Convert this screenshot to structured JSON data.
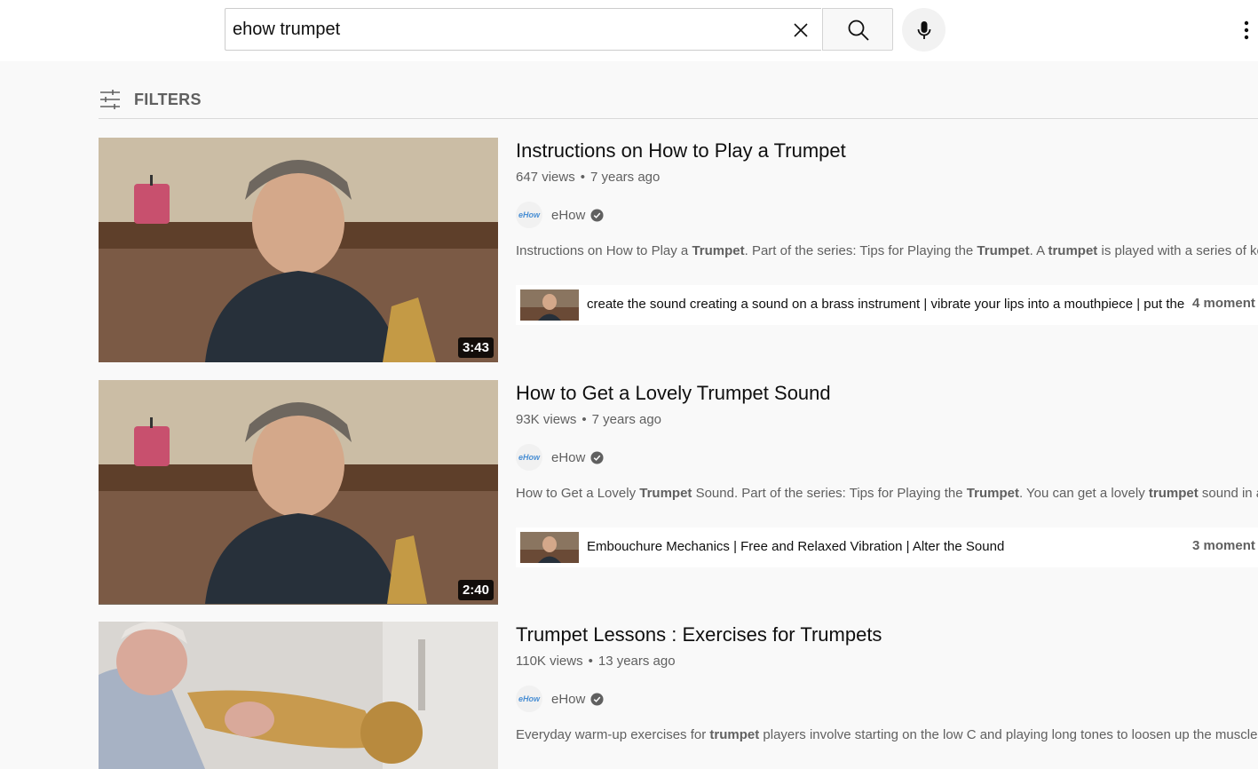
{
  "search": {
    "query": "ehow trumpet"
  },
  "filters": {
    "label": "FILTERS"
  },
  "results": [
    {
      "title": "Instructions on How to Play a Trumpet",
      "views": "647 views",
      "age": "7 years ago",
      "channel": "eHow",
      "avatar_text": "eHow",
      "duration": "3:43",
      "description": [
        {
          "t": "Instructions on How to Play a ",
          "b": false
        },
        {
          "t": "Trumpet",
          "b": true
        },
        {
          "t": ". Part of the series: Tips for Playing the ",
          "b": false
        },
        {
          "t": "Trumpet",
          "b": true
        },
        {
          "t": ". A ",
          "b": false
        },
        {
          "t": "trumpet",
          "b": true
        },
        {
          "t": " is played with a series of key",
          "b": false
        }
      ],
      "moments_text": "create the sound creating a sound on a brass instrument | vibrate your lips into a mouthpiece | put the",
      "moments_count": "4 moment"
    },
    {
      "title": "How to Get a Lovely Trumpet Sound",
      "views": "93K views",
      "age": "7 years ago",
      "channel": "eHow",
      "avatar_text": "eHow",
      "duration": "2:40",
      "description": [
        {
          "t": "How to Get a Lovely ",
          "b": false
        },
        {
          "t": "Trumpet",
          "b": true
        },
        {
          "t": " Sound. Part of the series: Tips for Playing the ",
          "b": false
        },
        {
          "t": "Trumpet",
          "b": true
        },
        {
          "t": ". You can get a lovely ",
          "b": false
        },
        {
          "t": "trumpet",
          "b": true
        },
        {
          "t": " sound in a ...",
          "b": false
        }
      ],
      "moments_text": "Embouchure Mechanics | Free and Relaxed Vibration | Alter the Sound",
      "moments_count": "3 moment"
    },
    {
      "title": "Trumpet Lessons : Exercises for Trumpets",
      "views": "110K views",
      "age": "13 years ago",
      "channel": "eHow",
      "avatar_text": "eHow",
      "duration": "",
      "description": [
        {
          "t": "Everyday warm-up exercises for ",
          "b": false
        },
        {
          "t": "trumpet",
          "b": true
        },
        {
          "t": " players involve starting on the low C and playing long tones to loosen up the muscles.",
          "b": false
        }
      ],
      "moments_text": "",
      "moments_count": ""
    }
  ]
}
